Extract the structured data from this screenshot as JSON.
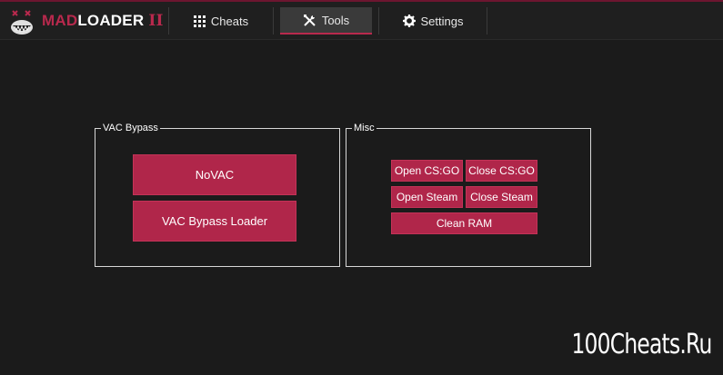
{
  "app": {
    "logo_mad": "MAD",
    "logo_loader": "LOADER",
    "logo_version": "II"
  },
  "tabs": [
    {
      "label": "Cheats",
      "icon": "grid-icon",
      "active": false
    },
    {
      "label": "Tools",
      "icon": "tools-icon",
      "active": true
    },
    {
      "label": "Settings",
      "icon": "gear-icon",
      "active": false
    }
  ],
  "vac_bypass": {
    "title": "VAC Bypass",
    "buttons": [
      "NoVAC",
      "VAC Bypass Loader"
    ]
  },
  "misc": {
    "title": "Misc",
    "buttons": [
      "Open CS:GO",
      "Close CS:GO",
      "Open Steam",
      "Close Steam",
      "Clean RAM"
    ]
  },
  "watermark": "100Cheats.Ru",
  "colors": {
    "accent": "#b0264a",
    "background": "#1b1b1b",
    "topbar": "#1f1f1f"
  }
}
